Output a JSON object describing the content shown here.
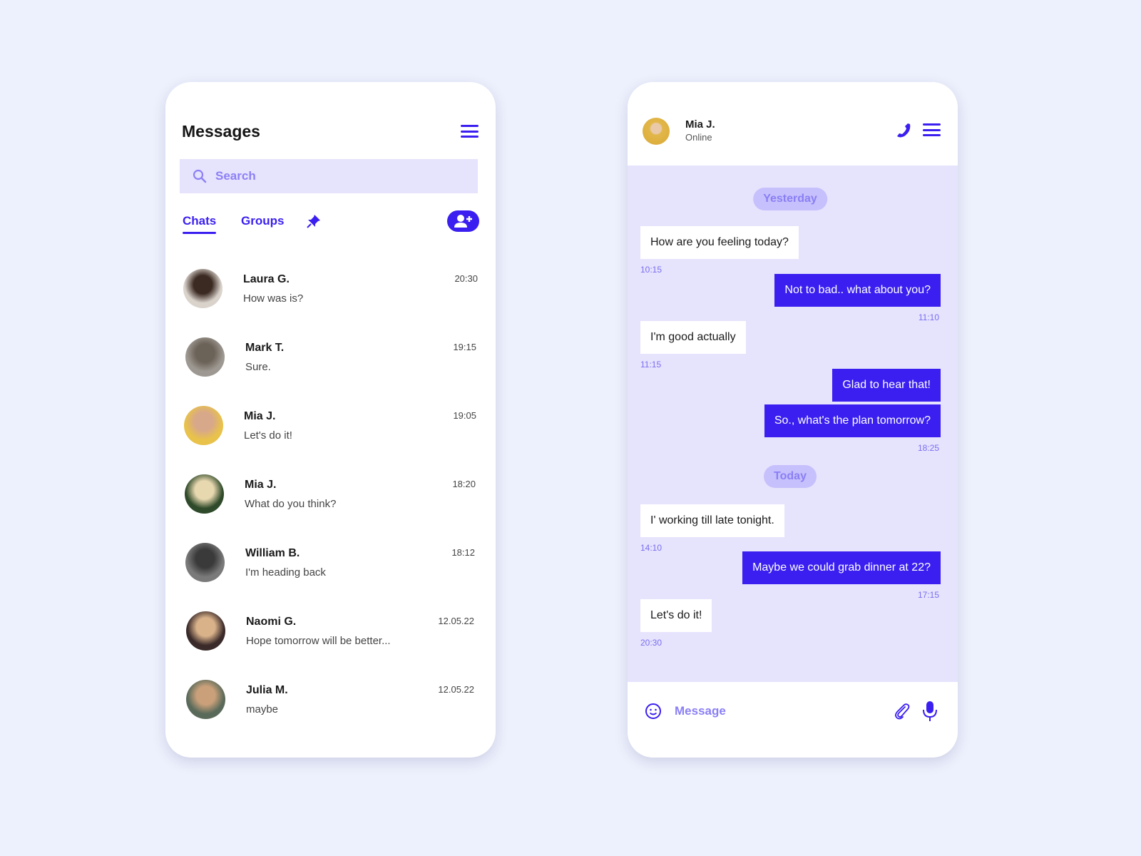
{
  "colors": {
    "accent": "#3a1ff0",
    "chat_bg": "#e6e3fd",
    "page_bg": "#edf1fd"
  },
  "list": {
    "title": "Messages",
    "search_placeholder": "Search",
    "tabs": [
      {
        "label": "Chats",
        "active": true
      },
      {
        "label": "Groups",
        "active": false
      }
    ],
    "icons": {
      "menu": "hamburger-icon",
      "search": "search-icon",
      "pin": "pin-icon",
      "add": "add-user-icon"
    },
    "chats": [
      {
        "name": "Laura G.",
        "preview": "How was is?",
        "time": "20:30"
      },
      {
        "name": "Mark T.",
        "preview": "Sure.",
        "time": "19:15"
      },
      {
        "name": "Mia J.",
        "preview": "Let's do it!",
        "time": "19:05"
      },
      {
        "name": "Mia J.",
        "preview": "What do you think?",
        "time": "18:20"
      },
      {
        "name": "William B.",
        "preview": "I'm heading back",
        "time": "18:12"
      },
      {
        "name": "Naomi G.",
        "preview": "Hope tomorrow will be better...",
        "time": "12.05.22"
      },
      {
        "name": "Julia M.",
        "preview": "maybe",
        "time": "12.05.22"
      }
    ]
  },
  "conversation": {
    "contact": {
      "name": "Mia J.",
      "status": "Online"
    },
    "icons": {
      "call": "phone-icon",
      "menu": "hamburger-icon",
      "emoji": "smiley-icon",
      "attach": "paperclip-icon",
      "mic": "microphone-icon"
    },
    "days": [
      "Yesterday",
      "Today"
    ],
    "messages": [
      {
        "text": "How are you feeling today?",
        "time": "10:15",
        "dir": "in"
      },
      {
        "text": "Not to bad.. what about you?",
        "time": "11:10",
        "dir": "out"
      },
      {
        "text": "I'm good actually",
        "time": "11:15",
        "dir": "in"
      },
      {
        "text": "Glad to hear that!",
        "time": "",
        "dir": "out"
      },
      {
        "text": "So., what's the plan tomorrow?",
        "time": "18:25",
        "dir": "out"
      },
      {
        "text": "I' working till late tonight.",
        "time": "14:10",
        "dir": "in"
      },
      {
        "text": "Maybe we could grab dinner at 22?",
        "time": "17:15",
        "dir": "out"
      },
      {
        "text": "Let's do it!",
        "time": "20:30",
        "dir": "in"
      }
    ],
    "input_placeholder": "Message"
  }
}
